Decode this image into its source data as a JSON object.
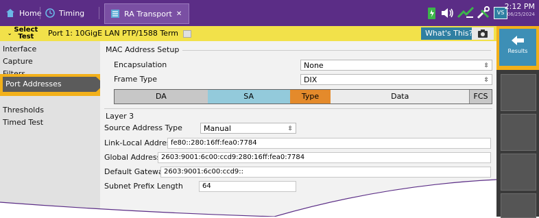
{
  "tabs": {
    "home": "Home",
    "timing": "Timing",
    "ra_transport": "RA Transport",
    "close": "✕"
  },
  "clock": {
    "time": "2:12 PM",
    "date": "06/25/2024"
  },
  "status": {
    "badge": "VS"
  },
  "select_row": {
    "select_test": "Select\nTest",
    "port_label": "Port 1: 10GigE LAN PTP/1588 Term",
    "whats_this": "What's This?"
  },
  "right_panel": {
    "results_label": "Results"
  },
  "nav": {
    "items": [
      "Interface",
      "Capture",
      "Filters",
      "Port Addresses",
      "Thresholds",
      "Timed Test"
    ]
  },
  "mac": {
    "title": "MAC Address Setup",
    "encapsulation_label": "Encapsulation",
    "encapsulation_value": "None",
    "frame_type_label": "Frame Type",
    "frame_type_value": "DIX",
    "segments": {
      "da": "DA",
      "sa": "SA",
      "type": "Type",
      "data": "Data",
      "fcs": "FCS"
    }
  },
  "layer3": {
    "title": "Layer 3",
    "source_type_label": "Source Address Type",
    "source_type_value": "Manual",
    "link_local_label": "Link-Local Address",
    "link_local_value": "fe80::280:16ff:fea0:7784",
    "global_label": "Global Address",
    "global_value": "2603:9001:6c00:ccd9:280:16ff:fea0:7784",
    "gateway_label": "Default Gateway",
    "gateway_value": "2603:9001:6c00:ccd9::",
    "prefix_label": "Subnet Prefix Length",
    "prefix_value": "64"
  },
  "colors": {
    "topbar": "#5b2d86",
    "yellow": "#f2e14a",
    "highlight": "#f2b01a",
    "sa": "#93cadb",
    "type": "#e48a2b"
  }
}
